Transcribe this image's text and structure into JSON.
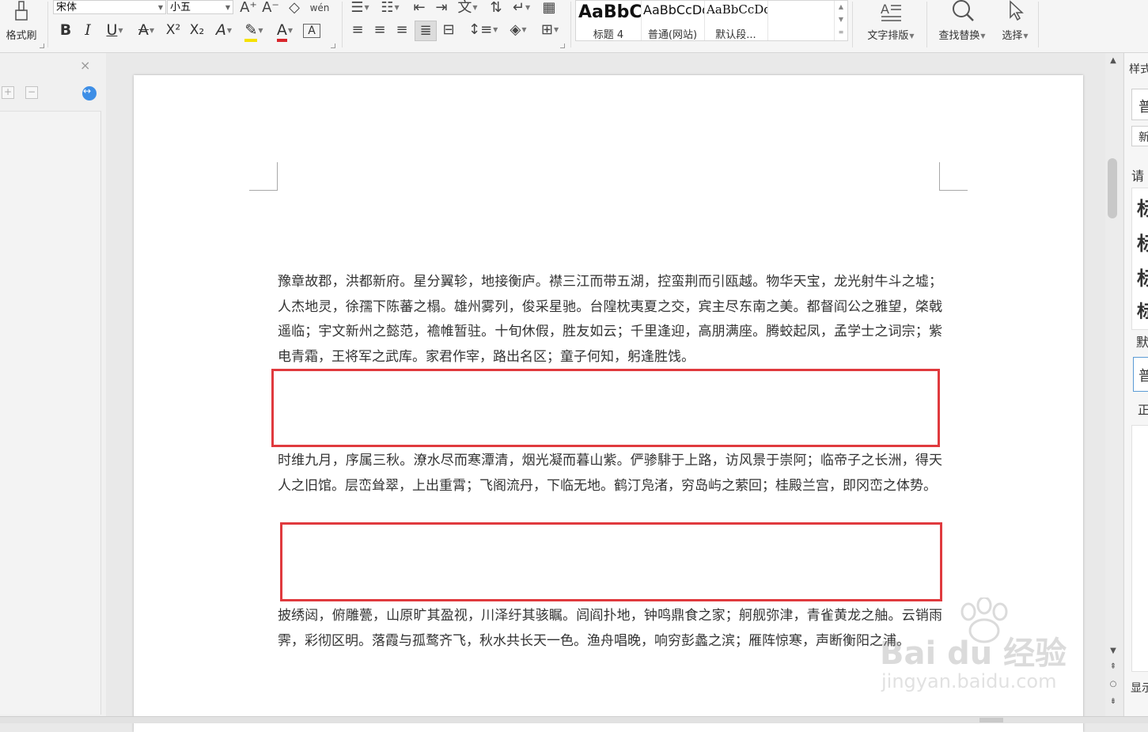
{
  "ribbon": {
    "format_painter": "格式刷",
    "font_name": "宋体",
    "font_size": "小五",
    "font_grow": "A⁺",
    "font_shrink": "A⁻",
    "clear_format": "◇",
    "phonetic": "wén",
    "bold": "B",
    "italic": "I",
    "underline": "U",
    "strikethrough": "A",
    "superscript": "X²",
    "subscript": "X₂",
    "text_effect": "A",
    "highlight": "✎",
    "font_color": "A",
    "char_border": "A",
    "styles": [
      {
        "sample": "AaBbC",
        "name": "标题 4"
      },
      {
        "sample": "AaBbCcDd",
        "name": "普通(网站)"
      },
      {
        "sample": "AaBbCcDd",
        "name": "默认段..."
      }
    ],
    "text_layout": "文字排版",
    "find_replace": "查找替换",
    "select": "选择"
  },
  "nav": {
    "close": "×",
    "expand": "+",
    "collapse": "−"
  },
  "document": {
    "paragraphs": [
      "豫章故郡，洪都新府。星分翼轸，地接衡庐。襟三江而带五湖，控蛮荆而引瓯越。物华天宝，龙光射牛斗之墟；人杰地灵，徐孺下陈蕃之榻。雄州雾列，俊采星驰。台隍枕夷夏之交，宾主尽东南之美。都督阎公之雅望，棨戟遥临；宇文新州之懿范，襜帷暂驻。十旬休假，胜友如云；千里逢迎，高朋满座。腾蛟起凤，孟学士之词宗；紫电青霜，王将军之武库。家君作宰，路出名区；童子何知，躬逢胜饯。",
      "时维九月，序属三秋。潦水尽而寒潭清，烟光凝而暮山紫。俨骖騑于上路，访风景于崇阿；临帝子之长洲，得天人之旧馆。层峦耸翠，上出重霄；飞阁流丹，下临无地。鹤汀凫渚，穷岛屿之萦回；桂殿兰宫，即冈峦之体势。",
      "披绣闼，俯雕甍，山原旷其盈视，川泽纡其骇瞩。闾阎扑地，钟鸣鼎食之家；舸舰弥津，青雀黄龙之舳。云销雨霁，彩彻区明。落霞与孤鹜齐飞，秋水共长天一色。渔舟唱晚，响穷彭蠡之滨；雁阵惊寒，声断衡阳之浦。"
    ]
  },
  "watermark": {
    "brand": "Bai du 经验",
    "url": "jingyan.baidu.com"
  },
  "right_pane": {
    "title": "样式",
    "current_style": "普",
    "new_style": "新",
    "prompt": "请",
    "preview": [
      "标",
      "标",
      "标",
      "标"
    ],
    "default": "默",
    "normal": "普",
    "body": "正",
    "show": "显示"
  },
  "colors": {
    "accent": "#3d8ee6",
    "highlight_box": "#e03a3e"
  }
}
